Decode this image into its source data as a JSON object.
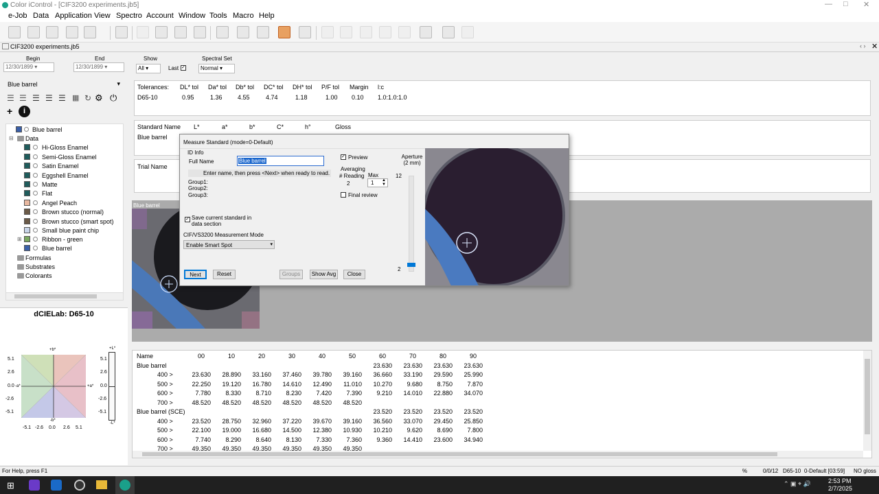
{
  "window": {
    "title": "Color iControl - [CIF3200 experiments.jb5]"
  },
  "menu": [
    "e-Job",
    "Data",
    "Application",
    "View",
    "Spectro",
    "Account",
    "Window",
    "Tools",
    "Macro",
    "Help"
  ],
  "doc_tab": "CIF3200 experiments.jb5",
  "filters": {
    "begin_label": "Begin",
    "begin_value": "12/30/1899",
    "end_label": "End",
    "end_value": "12/30/1899",
    "show_label": "Show",
    "show_value": "All",
    "last_label": "Last",
    "spectral_label": "Spectral Set",
    "spectral_value": "Normal"
  },
  "left": {
    "standard_selector": "Blue barrel",
    "tree": [
      {
        "label": "Blue barrel",
        "level": 1,
        "color": "#3a5fa8"
      },
      {
        "label": "Data",
        "level": 0,
        "folder": true
      },
      {
        "label": "Hi-Gloss Enamel",
        "level": 2,
        "color": "#1f5c5c"
      },
      {
        "label": "Semi-Gloss Enamel",
        "level": 2,
        "color": "#1f5c5c"
      },
      {
        "label": "Satin Enamel",
        "level": 2,
        "color": "#1f5c5c"
      },
      {
        "label": "Eggshell Enamel",
        "level": 2,
        "color": "#1f5c5c"
      },
      {
        "label": "Matte",
        "level": 2,
        "color": "#1f5c5c"
      },
      {
        "label": "Flat",
        "level": 2,
        "color": "#1f5c5c"
      },
      {
        "label": "Angel Peach",
        "level": 2,
        "color": "#e8b8a0"
      },
      {
        "label": "Brown stucco (normal)",
        "level": 2,
        "color": "#6b5a48"
      },
      {
        "label": "Brown stucco (smart spot)",
        "level": 2,
        "color": "#6b5a48"
      },
      {
        "label": "Small blue paint chip",
        "level": 2,
        "color": "#c8d4e8"
      },
      {
        "label": "Ribbon - green",
        "level": 2,
        "color": "#7aa860"
      },
      {
        "label": "Blue barrel",
        "level": 2,
        "color": "#3a5fa8"
      },
      {
        "label": "Formulas",
        "level": 0,
        "folder": true
      },
      {
        "label": "Substrates",
        "level": 0,
        "folder": true
      },
      {
        "label": "Colorants",
        "level": 0,
        "folder": true
      }
    ],
    "chart_title": "dCIELab: D65-10",
    "chart_axes": {
      "pos_b": "+b*",
      "neg_b": "-b*",
      "pos_a": "+a*",
      "neg_a": "-a*",
      "pos_L": "+L*",
      "neg_L": "-L*"
    },
    "chart_ticks": [
      "5.1",
      "2.6",
      "0.0",
      "-2.6",
      "-5.1"
    ],
    "chart_xticks": [
      "-5.1",
      "-2.6",
      "0.0",
      "2.6",
      "5.1"
    ]
  },
  "tolerances": {
    "headers": [
      "Tolerances:",
      "DL* tol",
      "Da* tol",
      "Db* tol",
      "DC* tol",
      "DH* tol",
      "P/F tol",
      "Margin",
      "l:c"
    ],
    "values": [
      "D65-10",
      "0.95",
      "1.36",
      "4.55",
      "4.74",
      "1.18",
      "1.00",
      "0.10",
      "1.0:1.0:1.0"
    ]
  },
  "standard": {
    "headers": [
      "Standard Name",
      "L*",
      "a*",
      "b*",
      "C*",
      "h°",
      "Gloss"
    ],
    "name": "Blue barrel"
  },
  "trial": {
    "header": "Trial Name"
  },
  "image_label": "Blue barrel",
  "table": {
    "headers": [
      "Name",
      "00",
      "10",
      "20",
      "30",
      "40",
      "50",
      "60",
      "70",
      "80",
      "90"
    ],
    "groups": [
      {
        "name": "Blue barrel",
        "summary": [
          "23.630",
          "23.630",
          "23.630",
          "23.630"
        ],
        "rows": [
          {
            "label": "400 >",
            "values": [
              "23.630",
              "28.890",
              "33.160",
              "37.460",
              "39.780",
              "39.160",
              "36.660",
              "33.190",
              "29.590",
              "25.990"
            ]
          },
          {
            "label": "500 >",
            "values": [
              "22.250",
              "19.120",
              "16.780",
              "14.610",
              "12.490",
              "11.010",
              "10.270",
              "9.680",
              "8.750",
              "7.870"
            ]
          },
          {
            "label": "600 >",
            "values": [
              "7.780",
              "8.330",
              "8.710",
              "8.230",
              "7.420",
              "7.390",
              "9.210",
              "14.010",
              "22.880",
              "34.070"
            ]
          },
          {
            "label": "700 >",
            "values": [
              "48.520",
              "48.520",
              "48.520",
              "48.520",
              "48.520",
              "48.520",
              "",
              "",
              "",
              ""
            ]
          }
        ]
      },
      {
        "name": "Blue barrel (SCE)",
        "summary": [
          "23.520",
          "23.520",
          "23.520",
          "23.520"
        ],
        "rows": [
          {
            "label": "400 >",
            "values": [
              "23.520",
              "28.750",
              "32.960",
              "37.220",
              "39.670",
              "39.160",
              "36.560",
              "33.070",
              "29.450",
              "25.850"
            ]
          },
          {
            "label": "500 >",
            "values": [
              "22.100",
              "19.000",
              "16.680",
              "14.500",
              "12.380",
              "10.930",
              "10.210",
              "9.620",
              "8.690",
              "7.800"
            ]
          },
          {
            "label": "600 >",
            "values": [
              "7.740",
              "8.290",
              "8.640",
              "8.130",
              "7.330",
              "7.360",
              "9.360",
              "14.410",
              "23.600",
              "34.940"
            ]
          },
          {
            "label": "700 >",
            "values": [
              "49.350",
              "49.350",
              "49.350",
              "49.350",
              "49.350",
              "49.350",
              "",
              "",
              "",
              ""
            ]
          }
        ]
      }
    ]
  },
  "dialog": {
    "title": "Measure Standard   (mode=0-Default)",
    "id_info": "ID Info",
    "full_name_label": "Full Name",
    "full_name_value": "Blue barrel",
    "hint": "Enter name, then press <Next> when ready to read.",
    "group1": "Group1:",
    "group2": "Group2:",
    "group3": "Group3:",
    "save_label": "Save current standard in data section",
    "mode_label": "CIF/VS3200 Measurement Mode",
    "mode_value": "Enable Smart Spot",
    "preview_label": "Preview",
    "averaging_label": "Averaging",
    "reading_label": "# Reading",
    "max_label": "Max",
    "reading_value": "2",
    "max_value": "1",
    "final_review_label": "Final review",
    "aperture_label": "Aperture (2 mm)",
    "slider_max": "12",
    "slider_value": "2",
    "slider_level": 0.09,
    "buttons": {
      "next": "Next",
      "reset": "Reset",
      "groups": "Groups",
      "show_avg": "Show Avg",
      "close": "Close"
    }
  },
  "status": {
    "help": "For Help, press F1",
    "pct": "%",
    "count": "0/0/12",
    "illum": "D65-10",
    "mode": "0-Default [03:59]",
    "gloss": "NO gloss"
  },
  "clock": {
    "time": "2:53 PM",
    "date": "2/7/2025"
  }
}
